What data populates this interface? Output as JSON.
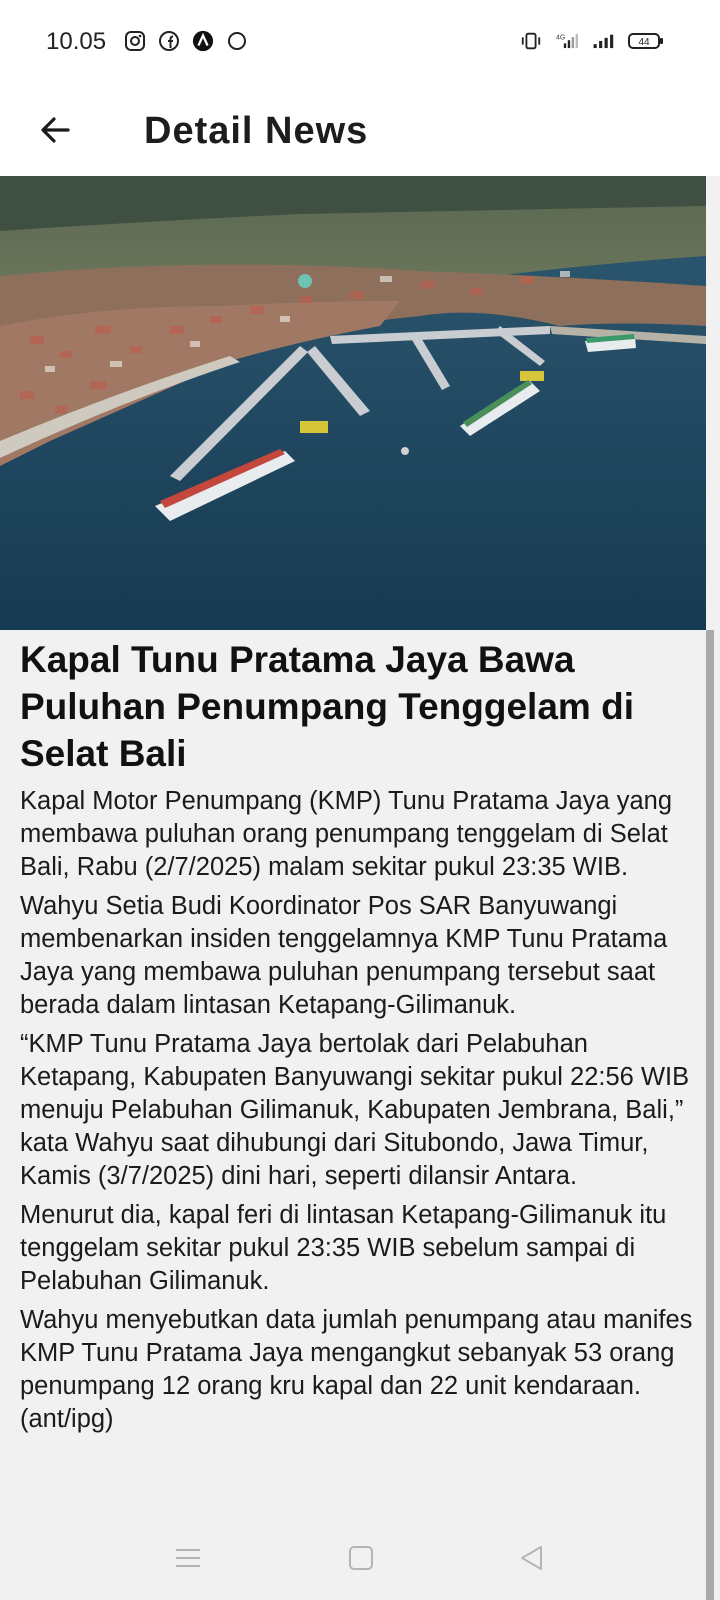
{
  "status_bar": {
    "time": "10.05",
    "battery": "44",
    "left_icons": [
      "instagram-icon",
      "facebook-icon",
      "app-a-icon",
      "circle-icon"
    ],
    "right_icons": [
      "vibrate-icon",
      "4g-signal-icon",
      "signal-icon",
      "battery-icon"
    ]
  },
  "app_bar": {
    "title": "Detail News"
  },
  "article": {
    "title": "Kapal Tunu Pratama Jaya Bawa Puluhan Penumpang Tenggelam di Selat Bali",
    "paragraphs": [
      "Kapal Motor Penumpang (KMP) Tunu Pratama Jaya yang membawa puluhan orang penumpang tenggelam di Selat Bali, Rabu (2/7/2025) malam sekitar pukul 23:35 WIB.",
      "Wahyu Setia Budi Koordinator Pos SAR Banyuwangi membenarkan insiden tenggelamnya KMP Tunu Pratama Jaya yang membawa puluhan penumpang tersebut saat berada dalam lintasan Ketapang-Gilimanuk.",
      "“KMP Tunu Pratama Jaya bertolak dari Pelabuhan Ketapang, Kabupaten Banyuwangi sekitar pukul 22:56 WIB menuju Pelabuhan Gilimanuk, Kabupaten Jembrana, Bali,” kata Wahyu saat dihubungi dari Situbondo, Jawa Timur, Kamis (3/7/2025) dini hari, seperti dilansir Antara.",
      "Menurut dia, kapal feri di lintasan Ketapang-Gilimanuk itu tenggelam sekitar pukul 23:35 WIB sebelum sampai di Pelabuhan Gilimanuk.",
      "Wahyu menyebutkan data jumlah penumpang atau manifes KMP Tunu Pratama Jaya mengangkut sebanyak 53 orang penumpang 12 orang kru kapal dan 22 unit kendaraan.(ant/ipg)"
    ]
  },
  "nav_bar": {
    "icons": [
      "menu-icon",
      "home-icon",
      "back-triangle-icon"
    ]
  },
  "colors": {
    "background": "#f1f1f1",
    "bar_background": "#ffffff",
    "text": "#1b1b1b",
    "sea": "#1e4763"
  }
}
